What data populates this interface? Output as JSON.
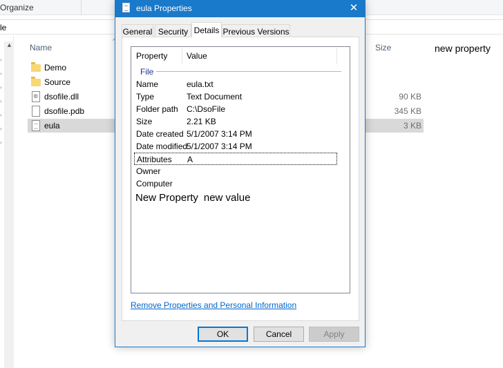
{
  "explorer": {
    "toolbar": {
      "organize": "Organize"
    },
    "address": {
      "text": "le"
    },
    "columns": {
      "name": "Name",
      "size": "Size",
      "new_property": "new property"
    },
    "files": [
      {
        "name": "Demo",
        "size": "",
        "type": "folder"
      },
      {
        "name": "Source",
        "size": "",
        "type": "folder"
      },
      {
        "name": "dsofile.dll",
        "size": "90 KB",
        "type": "dll"
      },
      {
        "name": "dsofile.pdb",
        "size": "345 KB",
        "type": "pdb"
      },
      {
        "name": "eula",
        "size": "3 KB",
        "type": "txt",
        "selected": true
      }
    ]
  },
  "dialog": {
    "title": "eula Properties",
    "close_glyph": "✕",
    "tabs": [
      "General",
      "Security",
      "Details",
      "Previous Versions"
    ],
    "active_tab": "Details",
    "list": {
      "header_property": "Property",
      "header_value": "Value",
      "group": "File",
      "rows": [
        {
          "name": "Name",
          "value": "eula.txt"
        },
        {
          "name": "Type",
          "value": "Text Document"
        },
        {
          "name": "Folder path",
          "value": "C:\\DsoFile"
        },
        {
          "name": "Size",
          "value": "2.21 KB"
        },
        {
          "name": "Date created",
          "value": "5/1/2007 3:14 PM"
        },
        {
          "name": "Date modified",
          "value": "5/1/2007 3:14 PM"
        },
        {
          "name": "Attributes",
          "value": "A"
        },
        {
          "name": "Owner",
          "value": ""
        },
        {
          "name": "Computer",
          "value": ""
        }
      ],
      "new_property_name": "New Property",
      "new_property_value": "new value"
    },
    "link": "Remove Properties and Personal Information",
    "buttons": {
      "ok": "OK",
      "cancel": "Cancel",
      "apply": "Apply"
    }
  },
  "colors": {
    "titlebar": "#1979ca",
    "link": "#0066cc",
    "selection": "#d9d9d9"
  }
}
